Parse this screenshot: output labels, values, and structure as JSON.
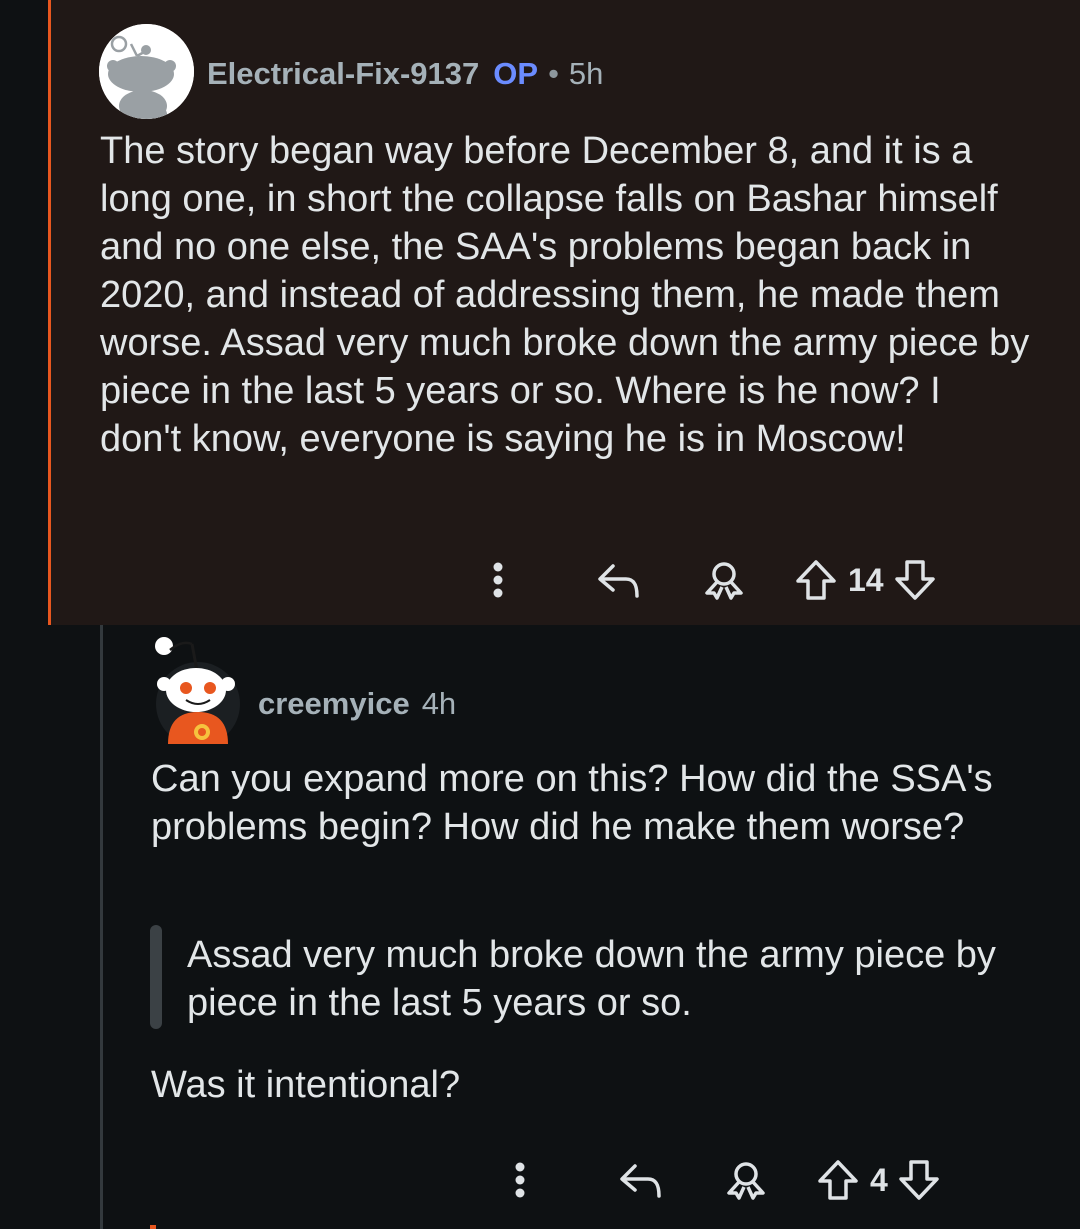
{
  "comments": [
    {
      "username": "Electrical-Fix-9137",
      "op_badge": "OP",
      "separator": "•",
      "time": "5h",
      "body": "The story began way before December 8, and it is a long one, in short the collapse falls on Bashar himself and no one else, the SAA's problems began back in 2020, and instead of addressing them, he made them worse. Assad very much broke down the army piece by piece in the last 5 years or so. Where is he now? I don't know, everyone is saying he is in Moscow!",
      "score": "14",
      "highlight_color": "#e8571f"
    },
    {
      "username": "creemyice",
      "time": "4h",
      "body": "Can you expand more on this? How did the SSA's problems begin? How did he make them worse?",
      "quote": "Assad very much broke down the army piece by piece in the last 5 years or so.",
      "body_after_quote": "Was it intentional?",
      "score": "4"
    }
  ],
  "icons": {
    "more": "more-vertical-icon",
    "reply": "reply-arrow-icon",
    "award": "award-icon",
    "upvote": "upvote-arrow-icon",
    "downvote": "downvote-arrow-icon"
  }
}
